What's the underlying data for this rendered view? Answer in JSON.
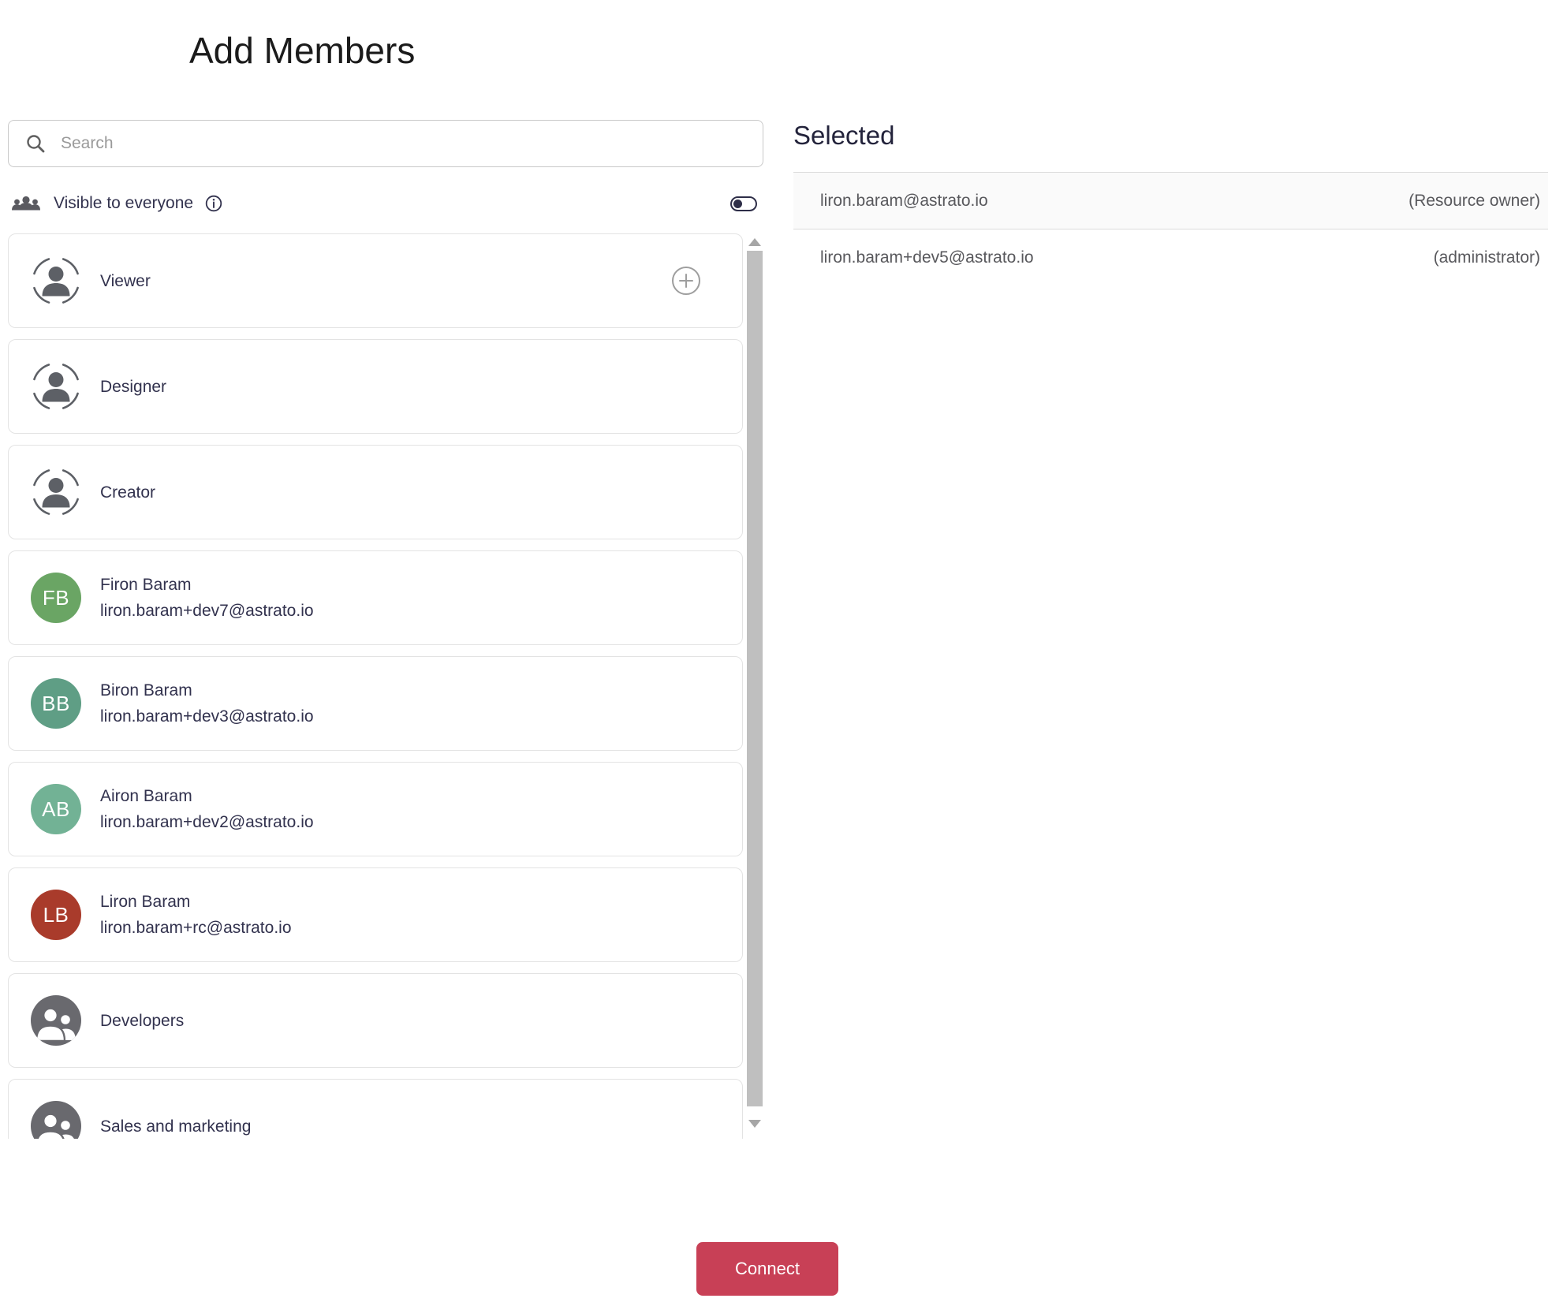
{
  "page": {
    "title": "Add Members"
  },
  "search": {
    "placeholder": "Search"
  },
  "visibility": {
    "label": "Visible to everyone",
    "toggle_state": "off"
  },
  "member_list": {
    "items": [
      {
        "type": "role",
        "label": "Viewer",
        "show_add": true
      },
      {
        "type": "role",
        "label": "Designer"
      },
      {
        "type": "role",
        "label": "Creator"
      },
      {
        "type": "user",
        "initials": "FB",
        "name": "Firon Baram",
        "email": "liron.baram+dev7@astrato.io",
        "avatar_color": "#6aa564"
      },
      {
        "type": "user",
        "initials": "BB",
        "name": "Biron Baram",
        "email": "liron.baram+dev3@astrato.io",
        "avatar_color": "#5f9e85"
      },
      {
        "type": "user",
        "initials": "AB",
        "name": "Airon Baram",
        "email": "liron.baram+dev2@astrato.io",
        "avatar_color": "#72b295"
      },
      {
        "type": "user",
        "initials": "LB",
        "name": "Liron Baram",
        "email": "liron.baram+rc@astrato.io",
        "avatar_color": "#a93b2b"
      },
      {
        "type": "group",
        "label": "Developers"
      },
      {
        "type": "group",
        "label": "Sales and marketing"
      }
    ]
  },
  "selected": {
    "heading": "Selected",
    "rows": [
      {
        "email": "liron.baram@astrato.io",
        "role": "(Resource owner)"
      },
      {
        "email": "liron.baram+dev5@astrato.io",
        "role": "(administrator)"
      }
    ]
  },
  "actions": {
    "connect_label": "Connect"
  },
  "colors": {
    "accent": "#c84056",
    "group_avatar_gray": "#69696e",
    "toggle": "#2e2e48",
    "scroll_thumb": "#bfbfbf"
  }
}
